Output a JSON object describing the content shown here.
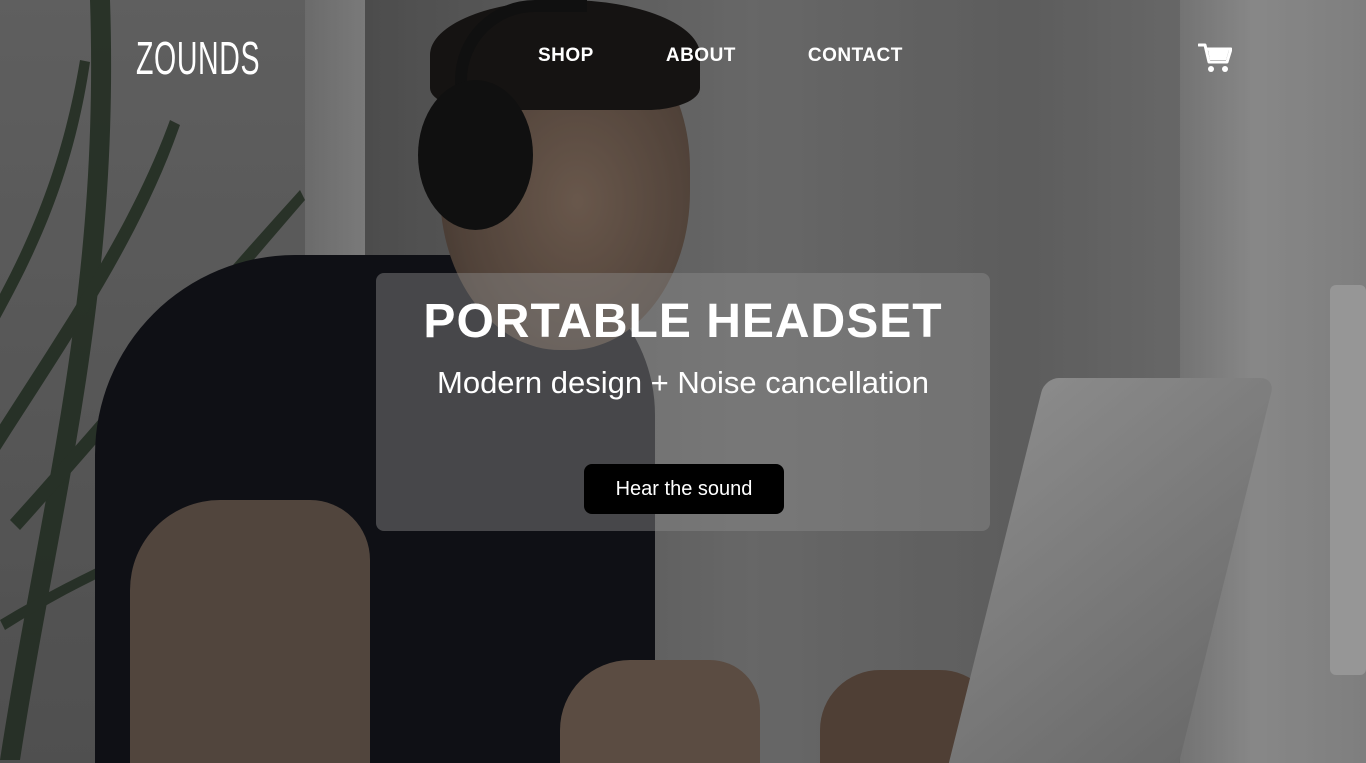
{
  "header": {
    "logo": "ZOUNDS",
    "nav": [
      {
        "label": "SHOP"
      },
      {
        "label": "ABOUT"
      },
      {
        "label": "CONTACT"
      }
    ],
    "cart_icon": "shopping-cart-icon"
  },
  "hero": {
    "title": "PORTABLE HEADSET",
    "subtitle": "Modern design + Noise cancellation",
    "cta_label": "Hear the sound",
    "background": "photo of a man wearing black over-ear headphones smiling at a laptop"
  },
  "colors": {
    "text": "#ffffff",
    "button_bg": "#000000",
    "card_bg": "rgba(140,140,140,0.45)"
  }
}
